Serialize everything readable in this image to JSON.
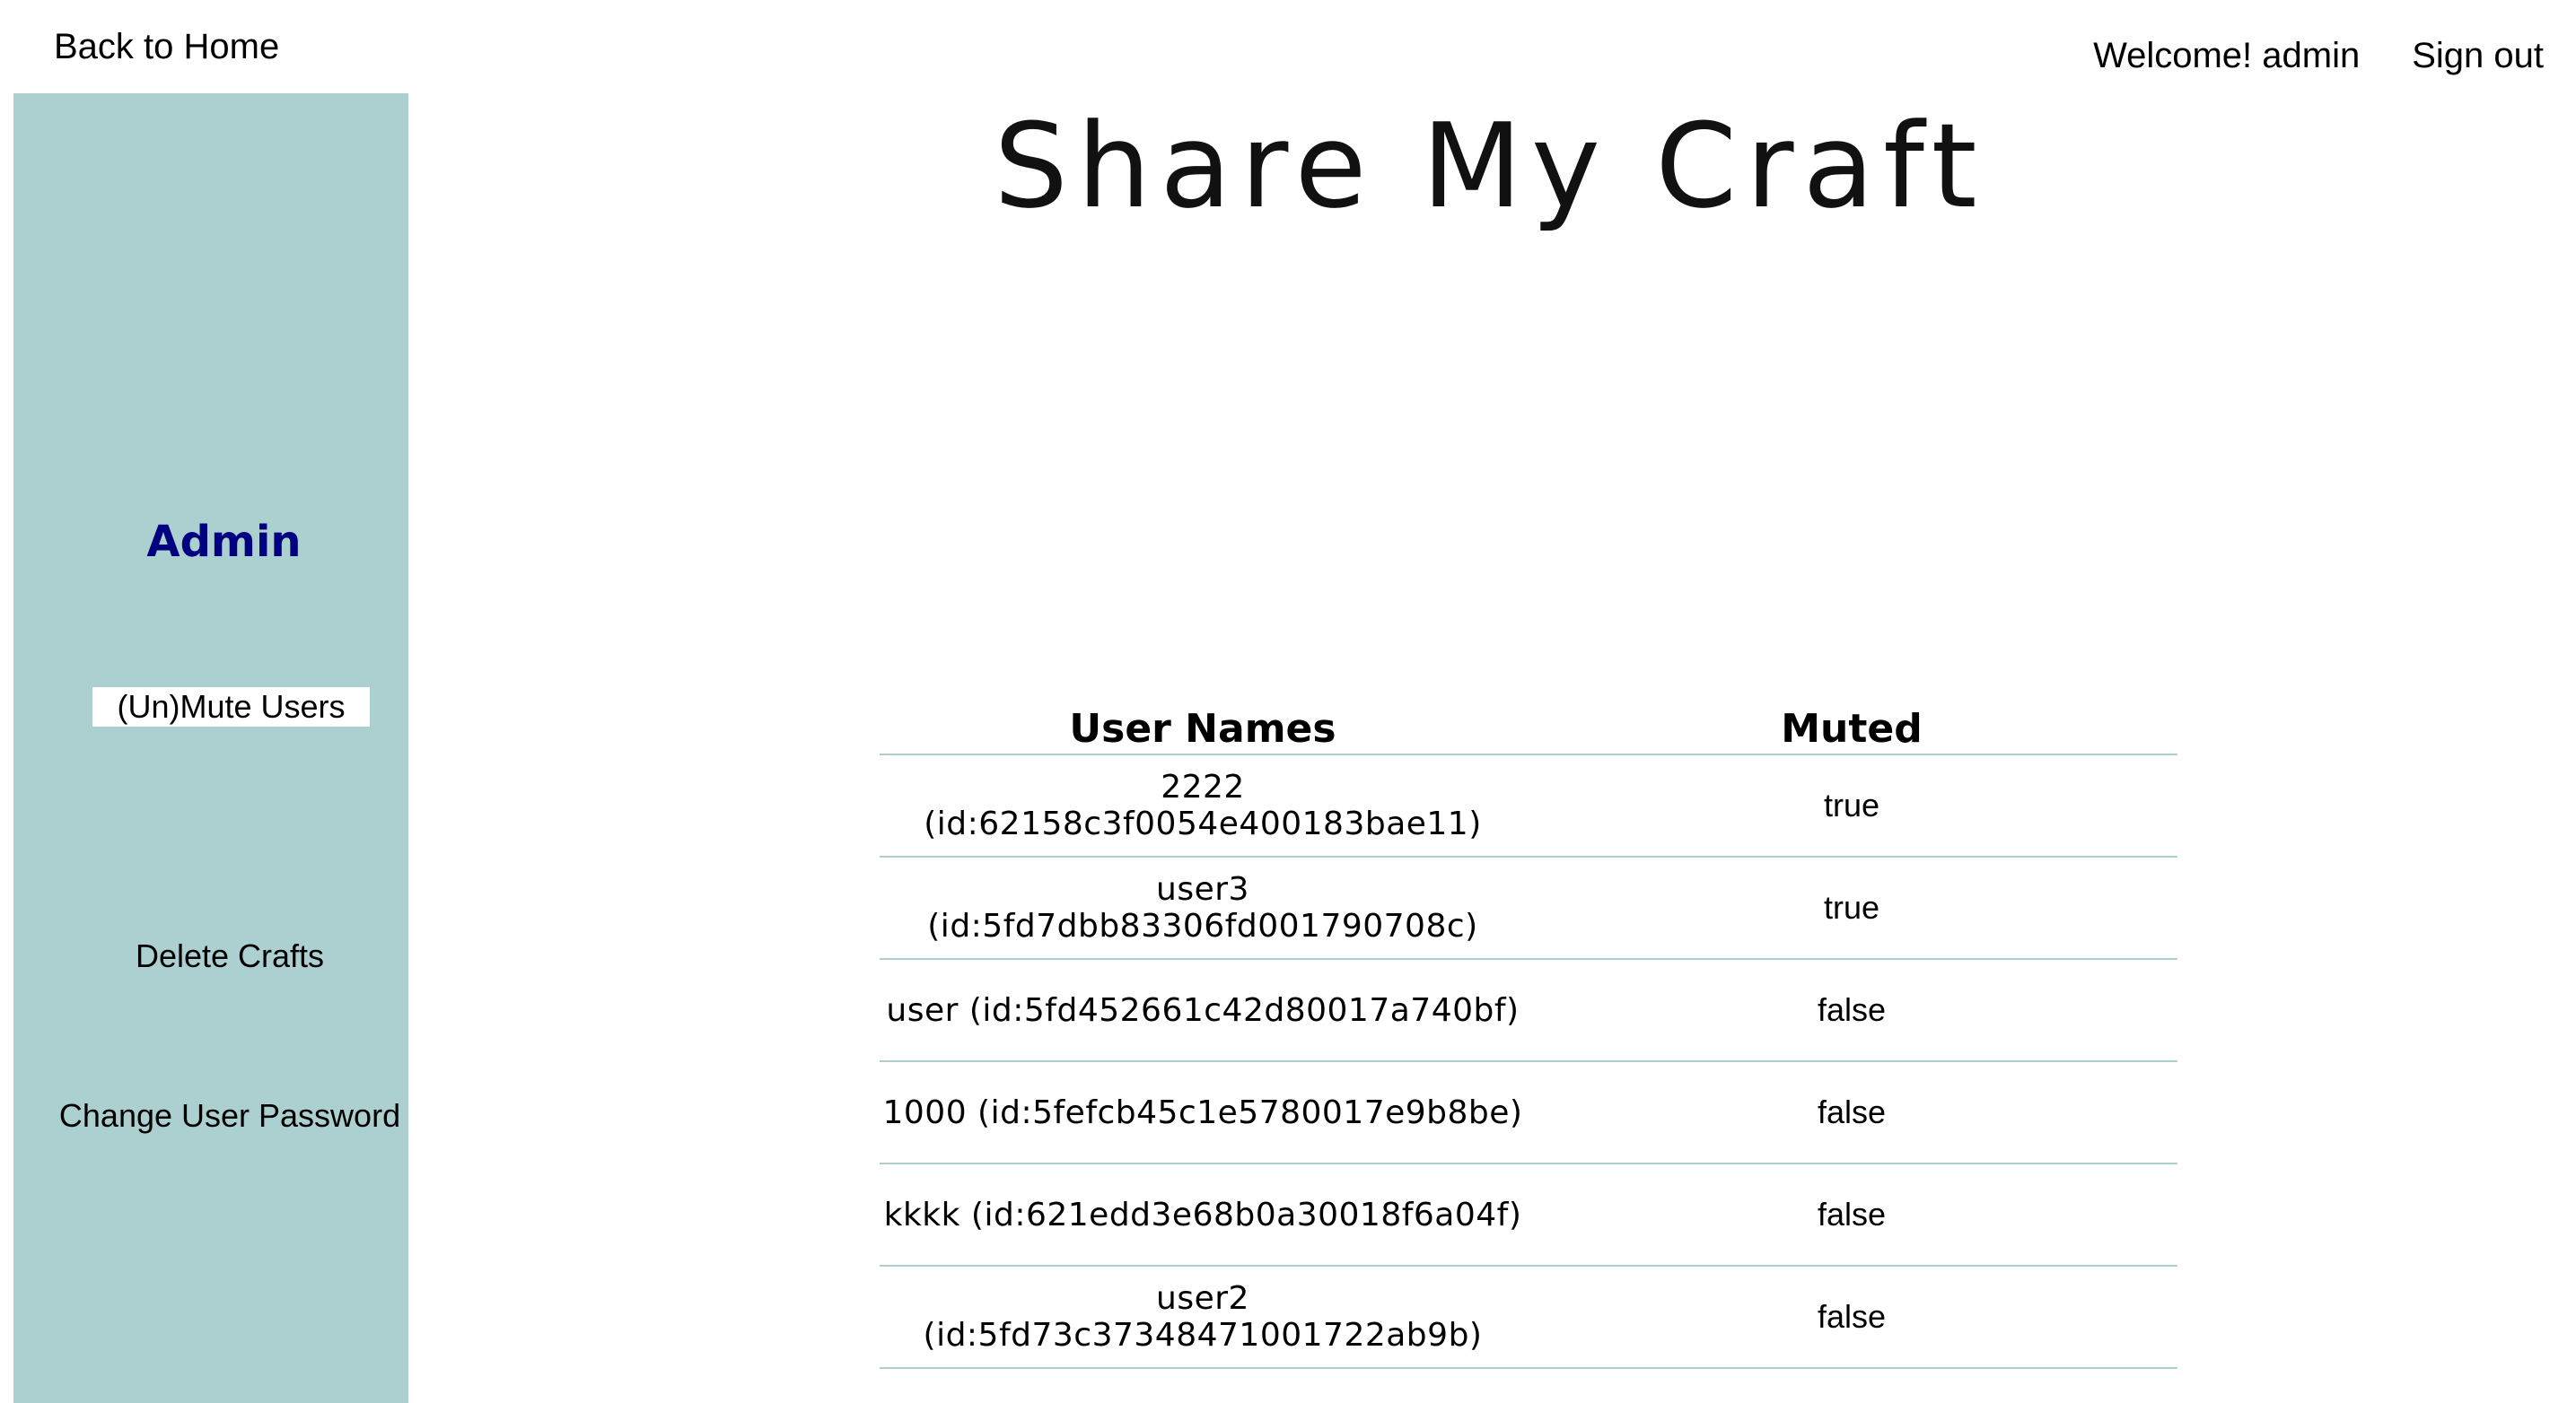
{
  "nav": {
    "back_home": "Back to Home",
    "welcome": "Welcome! admin",
    "sign_out": "Sign out"
  },
  "logo": {
    "text": "Share My Craft"
  },
  "sidebar": {
    "title": "Admin",
    "items": [
      {
        "label": "(Un)Mute Users",
        "active": true
      },
      {
        "label": "Delete Crafts",
        "active": false
      },
      {
        "label": "Change User Password",
        "active": false
      }
    ]
  },
  "table": {
    "headers": [
      "User Names",
      "Muted"
    ],
    "rows": [
      {
        "name": "2222 (id:62158c3f0054e400183bae11)",
        "muted": "true"
      },
      {
        "name": "user3 (id:5fd7dbb83306fd001790708c)",
        "muted": "true"
      },
      {
        "name": "user (id:5fd452661c42d80017a740bf)",
        "muted": "false"
      },
      {
        "name": "1000 (id:5fefcb45c1e5780017e9b8be)",
        "muted": "false"
      },
      {
        "name": "kkkk (id:621edd3e68b0a30018f6a04f)",
        "muted": "false"
      },
      {
        "name": "user2 (id:5fd73c37348471001722ab9b)",
        "muted": "false"
      }
    ]
  },
  "colors": {
    "sidebar_bg": "#acd0d0",
    "admin_title": "#000080",
    "row_border": "#acd0d0"
  }
}
